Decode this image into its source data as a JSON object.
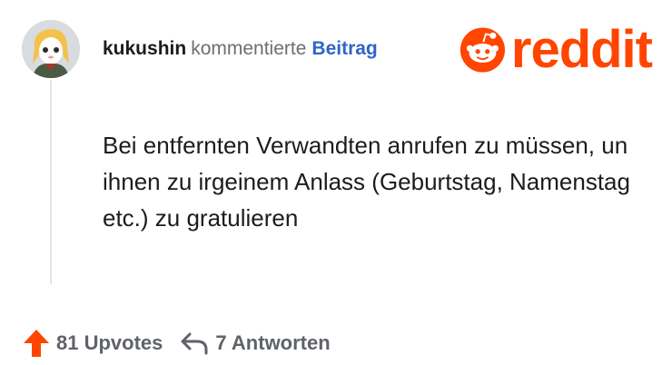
{
  "comment": {
    "username": "kukushin",
    "action": "kommentierte",
    "post_link": "Beitrag",
    "text": "Bei entfernten Verwandten anrufen zu müssen, un ihnen zu irgeinem Anlass (Geburtstag, Namenstag etc.) zu gratulieren"
  },
  "brand": {
    "name": "reddit",
    "color": "#ff4500"
  },
  "footer": {
    "upvotes": "81 Upvotes",
    "replies": "7 Antworten"
  },
  "icons": {
    "avatar": "avatar",
    "logo": "reddit-snoo-icon",
    "upvote": "upvote-arrow-icon",
    "reply": "reply-arrow-icon"
  }
}
